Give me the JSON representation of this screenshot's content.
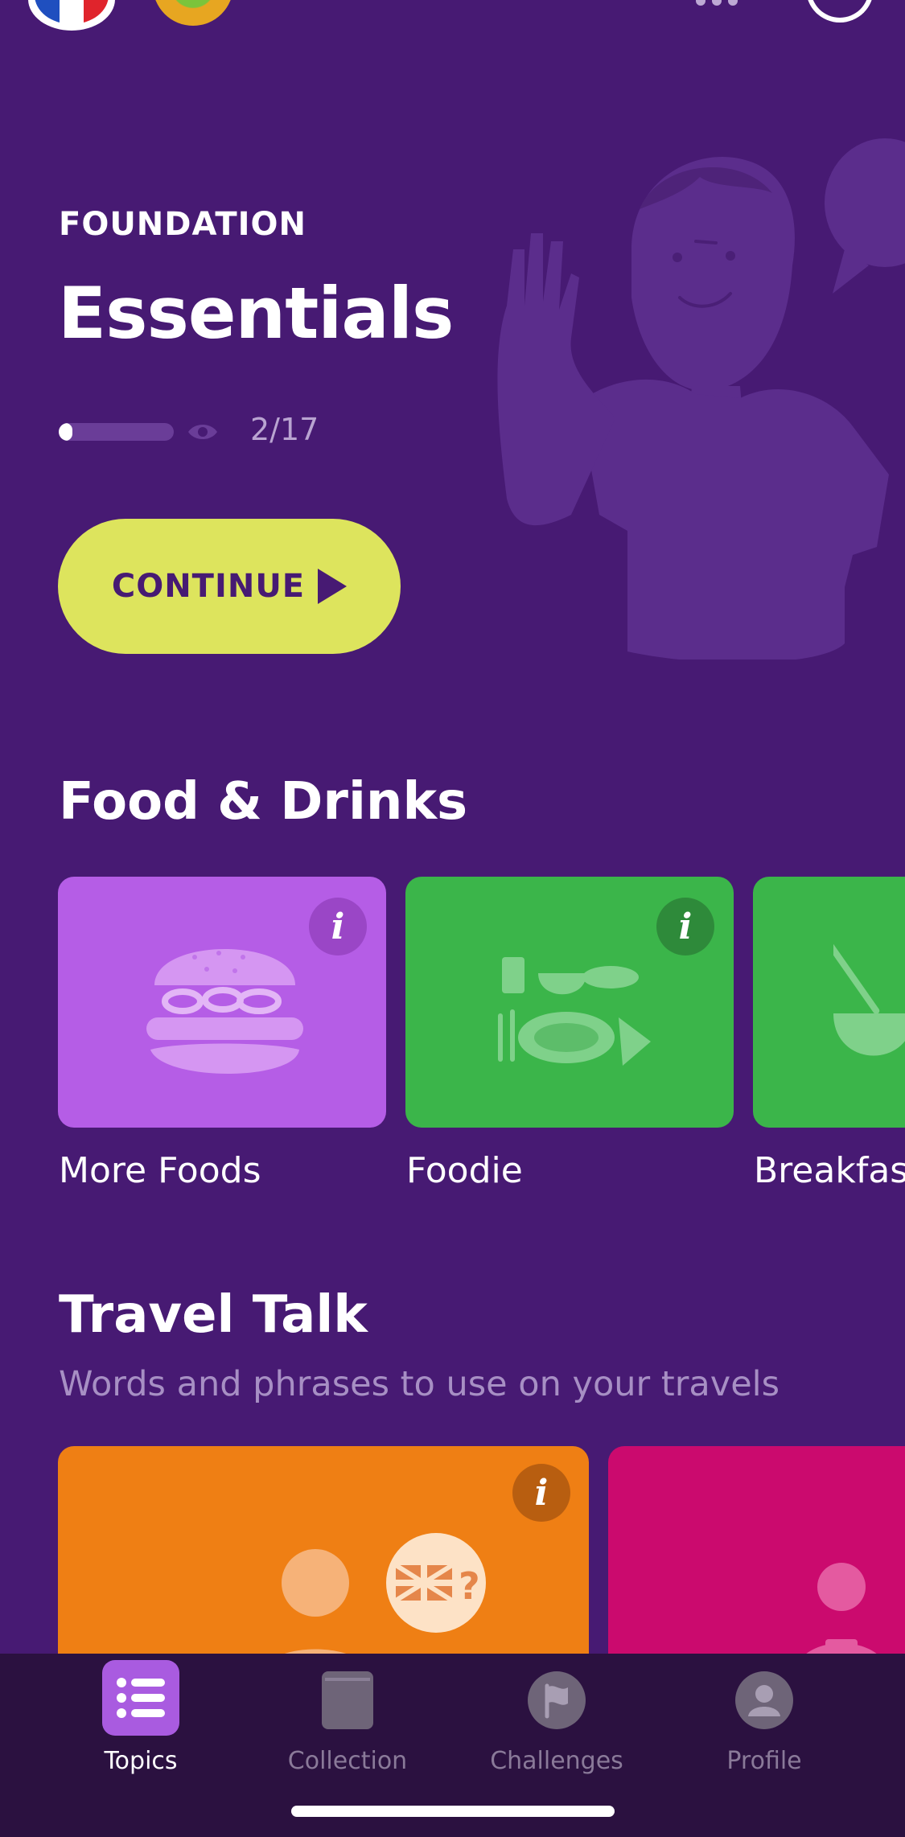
{
  "colors": {
    "background": "#471a73",
    "accent_button": "#dde45d",
    "card_purple": "#b55de6",
    "card_green": "#3bb54a",
    "card_orange": "#ef7f14",
    "card_pink": "#cb0a6e",
    "nav_background": "#2b1140"
  },
  "hero": {
    "eyebrow": "FOUNDATION",
    "title": "Essentials",
    "progress_fraction": 0.118,
    "progress_text": "2/17",
    "continue_label": "CONTINUE"
  },
  "food_section": {
    "title": "Food & Drinks",
    "cards": [
      {
        "label": "More Foods",
        "icon": "burger-icon"
      },
      {
        "label": "Foodie",
        "icon": "meal-icon"
      },
      {
        "label": "Breakfas",
        "icon": "bowl-icon"
      }
    ]
  },
  "travel_section": {
    "title": "Travel Talk",
    "subtitle": "Words and phrases to use on your travels"
  },
  "nav": {
    "items": [
      {
        "label": "Topics",
        "icon": "list-icon",
        "active": true
      },
      {
        "label": "Collection",
        "icon": "book-icon",
        "active": false
      },
      {
        "label": "Challenges",
        "icon": "flag-icon",
        "active": false
      },
      {
        "label": "Profile",
        "icon": "person-icon",
        "active": false
      }
    ]
  }
}
